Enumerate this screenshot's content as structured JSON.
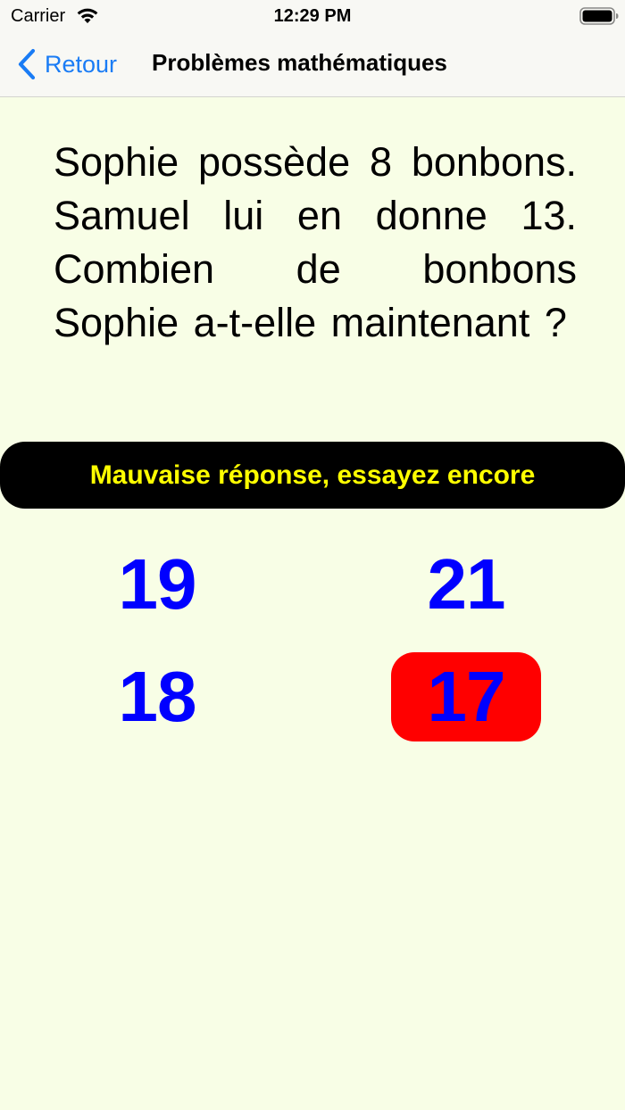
{
  "status_bar": {
    "carrier": "Carrier",
    "time": "12:29 PM",
    "wifi_icon": "wifi-icon",
    "battery_icon": "battery-icon"
  },
  "nav": {
    "back_label": "Retour",
    "back_icon": "chevron-left-icon",
    "title": "Problèmes mathématiques"
  },
  "question": "Sophie possède 8 bonbons. Samuel lui en donne 13. Combien de bonbons Sophie a-t-elle maintenant ?",
  "feedback": "Mauvaise réponse, essayez encore",
  "answers": [
    {
      "label": "19",
      "state": "default"
    },
    {
      "label": "21",
      "state": "default"
    },
    {
      "label": "18",
      "state": "default"
    },
    {
      "label": "17",
      "state": "wrong"
    }
  ],
  "colors": {
    "background": "#f8fee6",
    "accent": "#1a7cf5",
    "answer_text": "#0000ff",
    "wrong_background": "#ff0000",
    "feedback_background": "#000000",
    "feedback_text": "#ffff00"
  }
}
